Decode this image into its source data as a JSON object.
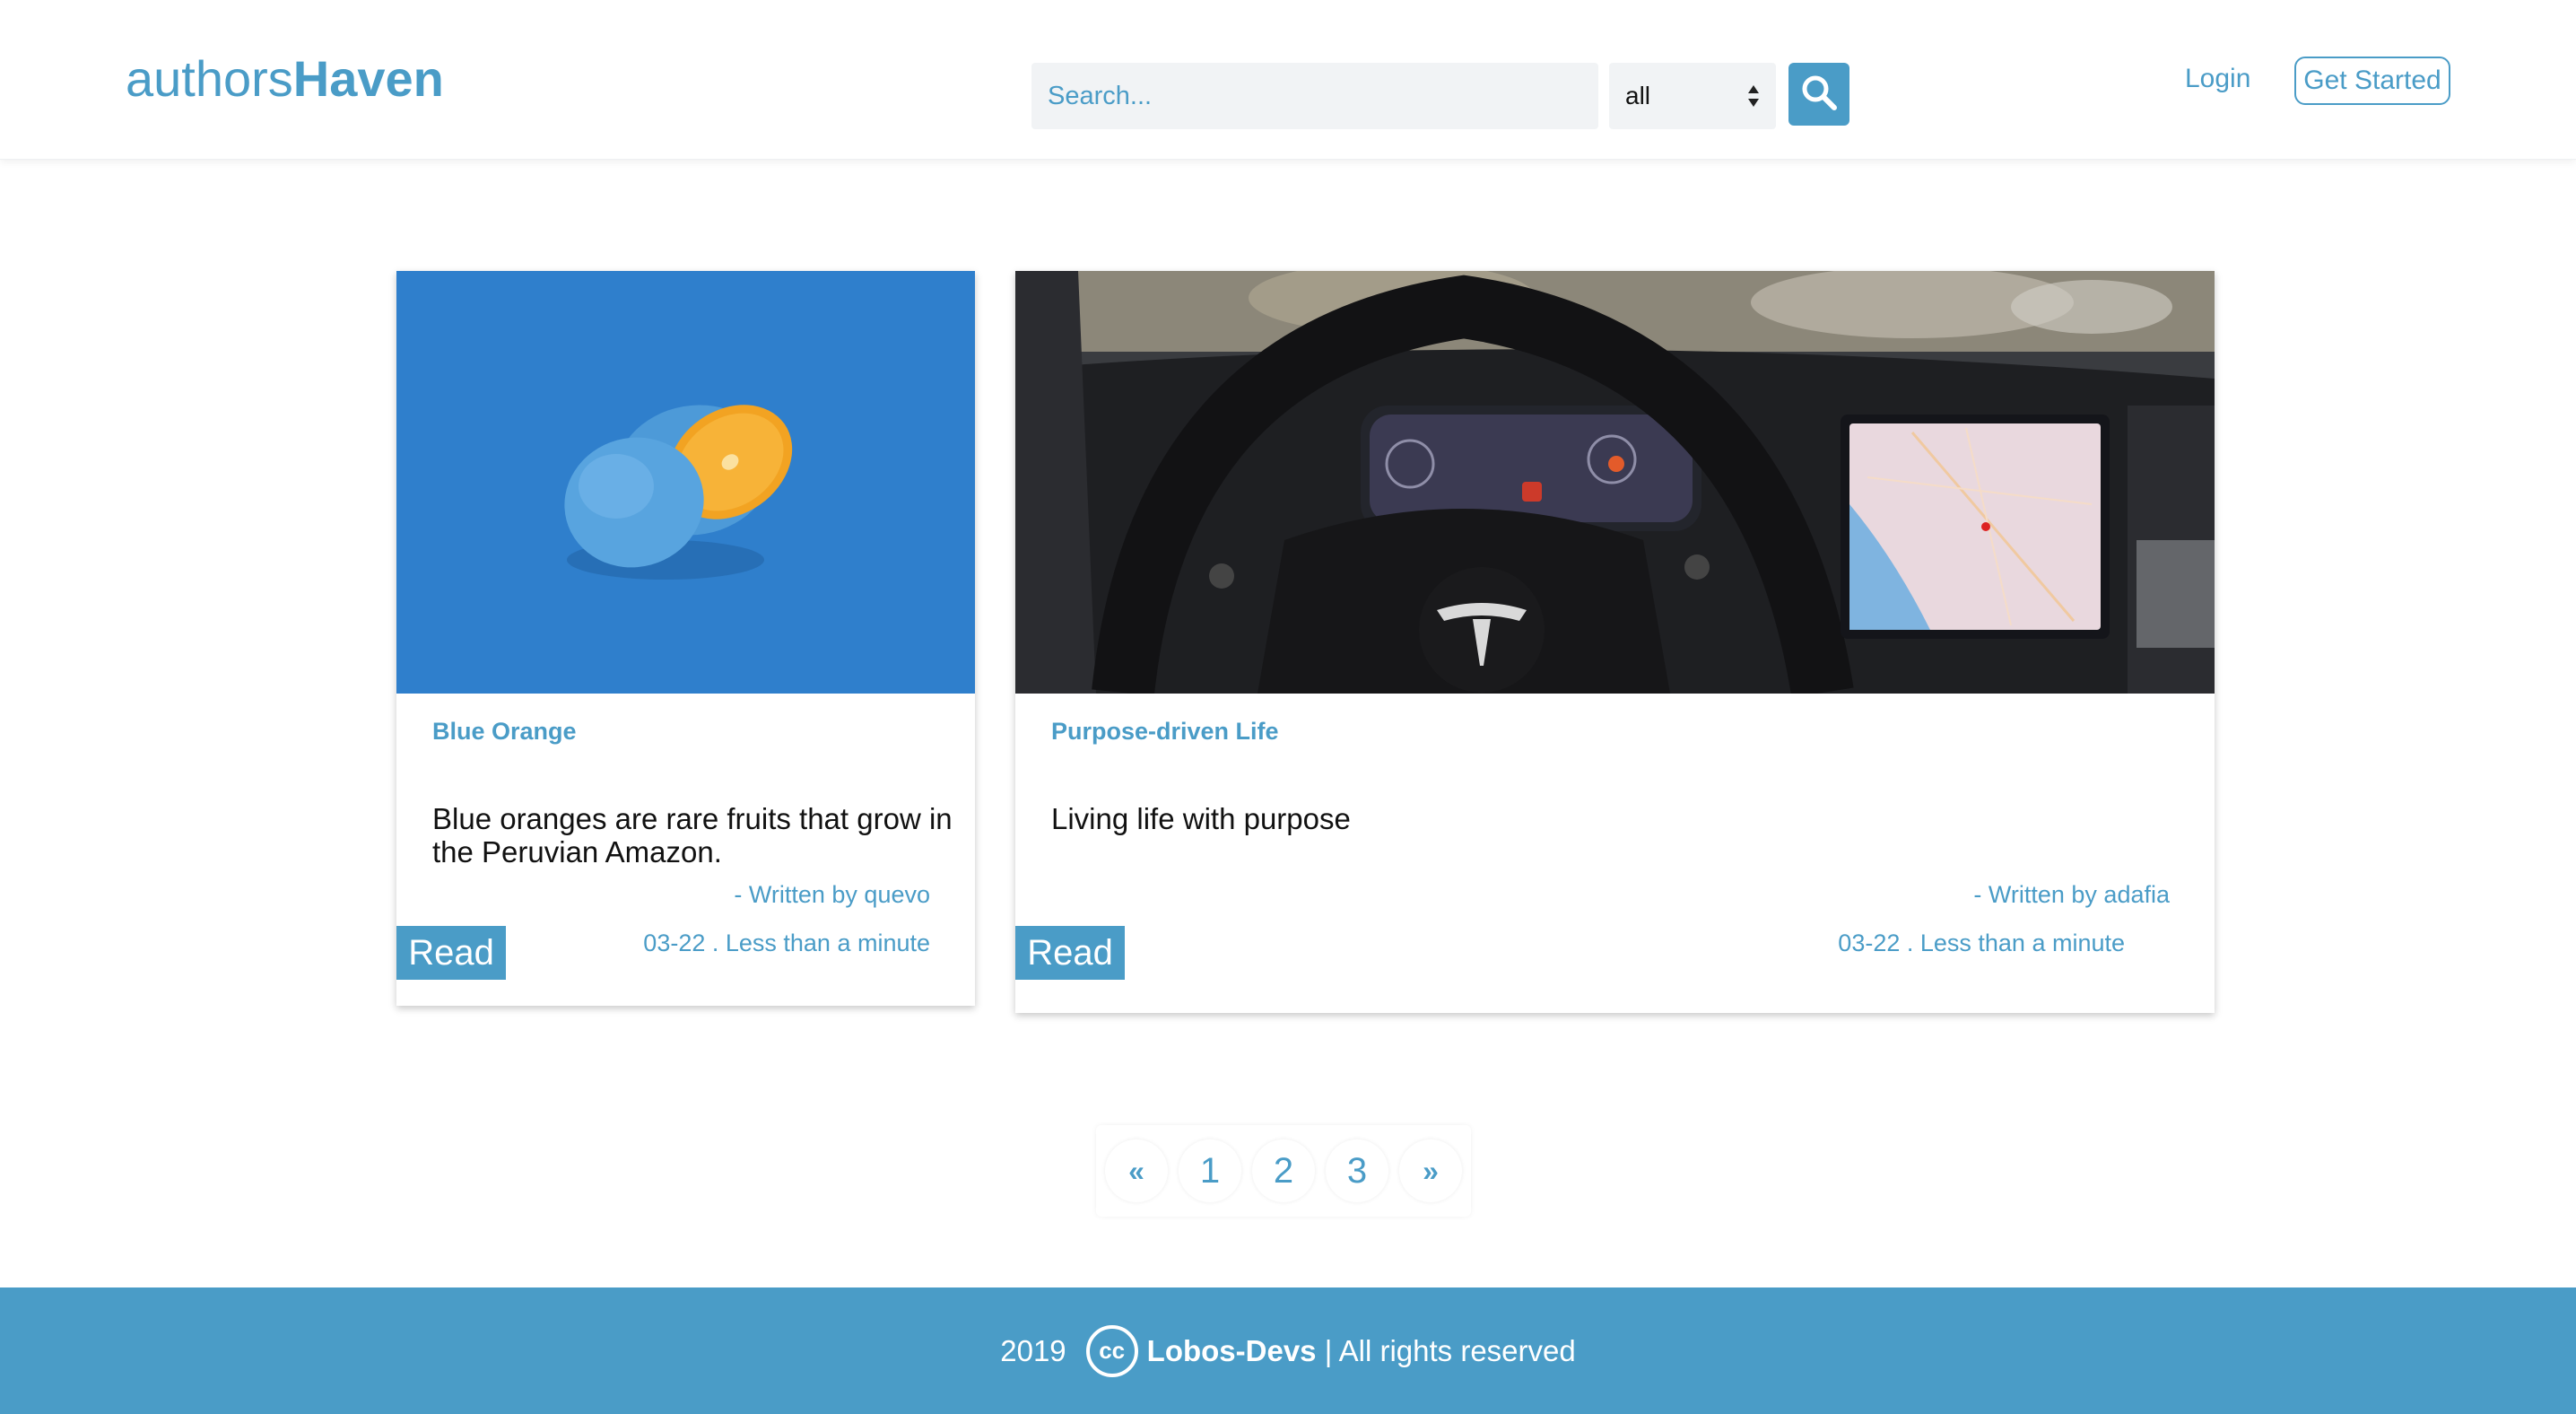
{
  "header": {
    "brand_light": "authors",
    "brand_bold": "Haven",
    "search_placeholder": "Search...",
    "filter_value": "all",
    "login_label": "Login",
    "get_started_label": "Get Started"
  },
  "articles": [
    {
      "title": "Blue Orange",
      "description": "Blue oranges are rare fruits that grow in the Peruvian Amazon.",
      "author": "- Written by quevo",
      "meta": "03-22 . Less than a minute",
      "read_label": "Read"
    },
    {
      "title": "Purpose-driven Life",
      "description": "Living life with purpose",
      "author": "- Written by adafia",
      "meta": "03-22 . Less than a minute",
      "read_label": "Read"
    }
  ],
  "pagination": {
    "prev": "«",
    "pages": [
      "1",
      "2",
      "3"
    ],
    "next": "»"
  },
  "footer": {
    "year": "2019",
    "cc": "cc",
    "org": "Lobos-Devs",
    "rights": "| All rights reserved"
  },
  "colors": {
    "accent": "#4a9cc7",
    "search_bg": "#f1f3f5",
    "text": "#111111"
  },
  "icons": {
    "search_button": "search-icon",
    "select_arrows": "select-arrows-icon",
    "license": "creative-commons-icon"
  }
}
